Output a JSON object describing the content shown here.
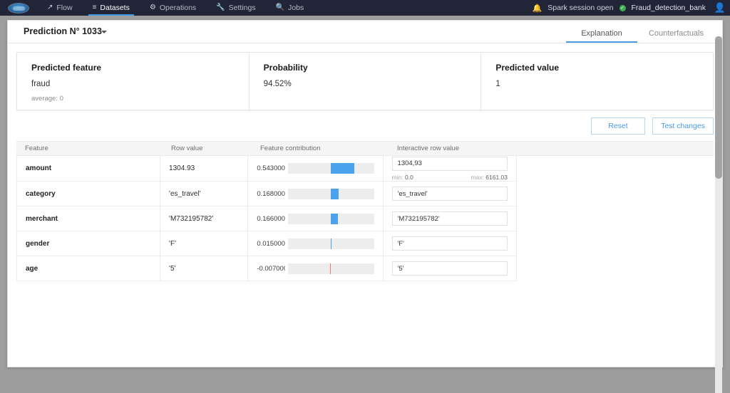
{
  "topbar": {
    "logo_name": "dataiku-logo",
    "nav": [
      {
        "label": "Flow",
        "icon": "chart-line-icon",
        "glyph": "↗",
        "active": false
      },
      {
        "label": "Datasets",
        "icon": "list-icon",
        "glyph": "≡",
        "active": true
      },
      {
        "label": "Operations",
        "icon": "gear-icon",
        "glyph": "⚙",
        "active": false
      },
      {
        "label": "Settings",
        "icon": "wrench-icon",
        "glyph": "🔧",
        "active": false
      },
      {
        "label": "Jobs",
        "icon": "search-jobs-icon",
        "glyph": "🔍",
        "active": false
      }
    ],
    "bell_icon": "notification-bell-icon",
    "bell_glyph": "🔔",
    "session_status": "Spark session open",
    "status_glyph": "✓",
    "project_name": "Fraud_detection_bank",
    "avatar_glyph": "👤"
  },
  "header": {
    "title": "Prediction N° 1033",
    "tabs": [
      {
        "label": "Explanation",
        "active": true
      },
      {
        "label": "Counterfactuals",
        "active": false
      }
    ]
  },
  "summary": {
    "predicted_feature": {
      "title": "Predicted feature",
      "value": "fraud",
      "sub": "average: 0"
    },
    "probability": {
      "title": "Probability",
      "value": "94.52%",
      "sub": ""
    },
    "predicted_value": {
      "title": "Predicted value",
      "value": "1",
      "sub": ""
    }
  },
  "toolbar": {
    "reset_label": "Reset",
    "test_changes_label": "Test changes"
  },
  "table": {
    "columns": [
      "Feature",
      "Row value",
      "Feature contribution",
      "Interactive row value"
    ],
    "rows": [
      {
        "feature": "amount",
        "row_value": "1304.93",
        "contribution_text": "0.543000",
        "contribution": 0.543,
        "interactive_value": "1304,93",
        "min_label": "min:",
        "min_value": "0.0",
        "max_label": "max:",
        "max_value": "6161.03",
        "has_range": true
      },
      {
        "feature": "category",
        "row_value": "'es_travel'",
        "contribution_text": "0.168000",
        "contribution": 0.168,
        "interactive_value": "'es_travel'",
        "has_range": false
      },
      {
        "feature": "merchant",
        "row_value": "'M732195782'",
        "contribution_text": "0.166000",
        "contribution": 0.166,
        "interactive_value": "'M732195782'",
        "has_range": false
      },
      {
        "feature": "gender",
        "row_value": "'F'",
        "contribution_text": "0.015000",
        "contribution": 0.015,
        "interactive_value": "'F'",
        "has_range": false
      },
      {
        "feature": "age",
        "row_value": "'5'",
        "contribution_text": "-0.007000",
        "contribution": -0.007,
        "interactive_value": "'5'",
        "has_range": false
      }
    ]
  },
  "chart_data": {
    "type": "bar",
    "title": "Feature contribution",
    "categories": [
      "amount",
      "category",
      "merchant",
      "gender",
      "age"
    ],
    "values": [
      0.543,
      0.168,
      0.166,
      0.015,
      -0.007
    ],
    "xlabel": "contribution",
    "ylabel": "",
    "xlim": [
      -1.0,
      1.0
    ],
    "grid": false,
    "orientation": "horizontal",
    "positive_color": "#4aa3ec",
    "negative_color": "#ec7b6e",
    "track_color": "#ededed"
  },
  "colors": {
    "accent": "#4a9ae4",
    "topbar_bg": "#222437",
    "status_green": "#3fae52",
    "positive_bar": "#4aa3ec",
    "negative_bar": "#ec7b6e"
  }
}
